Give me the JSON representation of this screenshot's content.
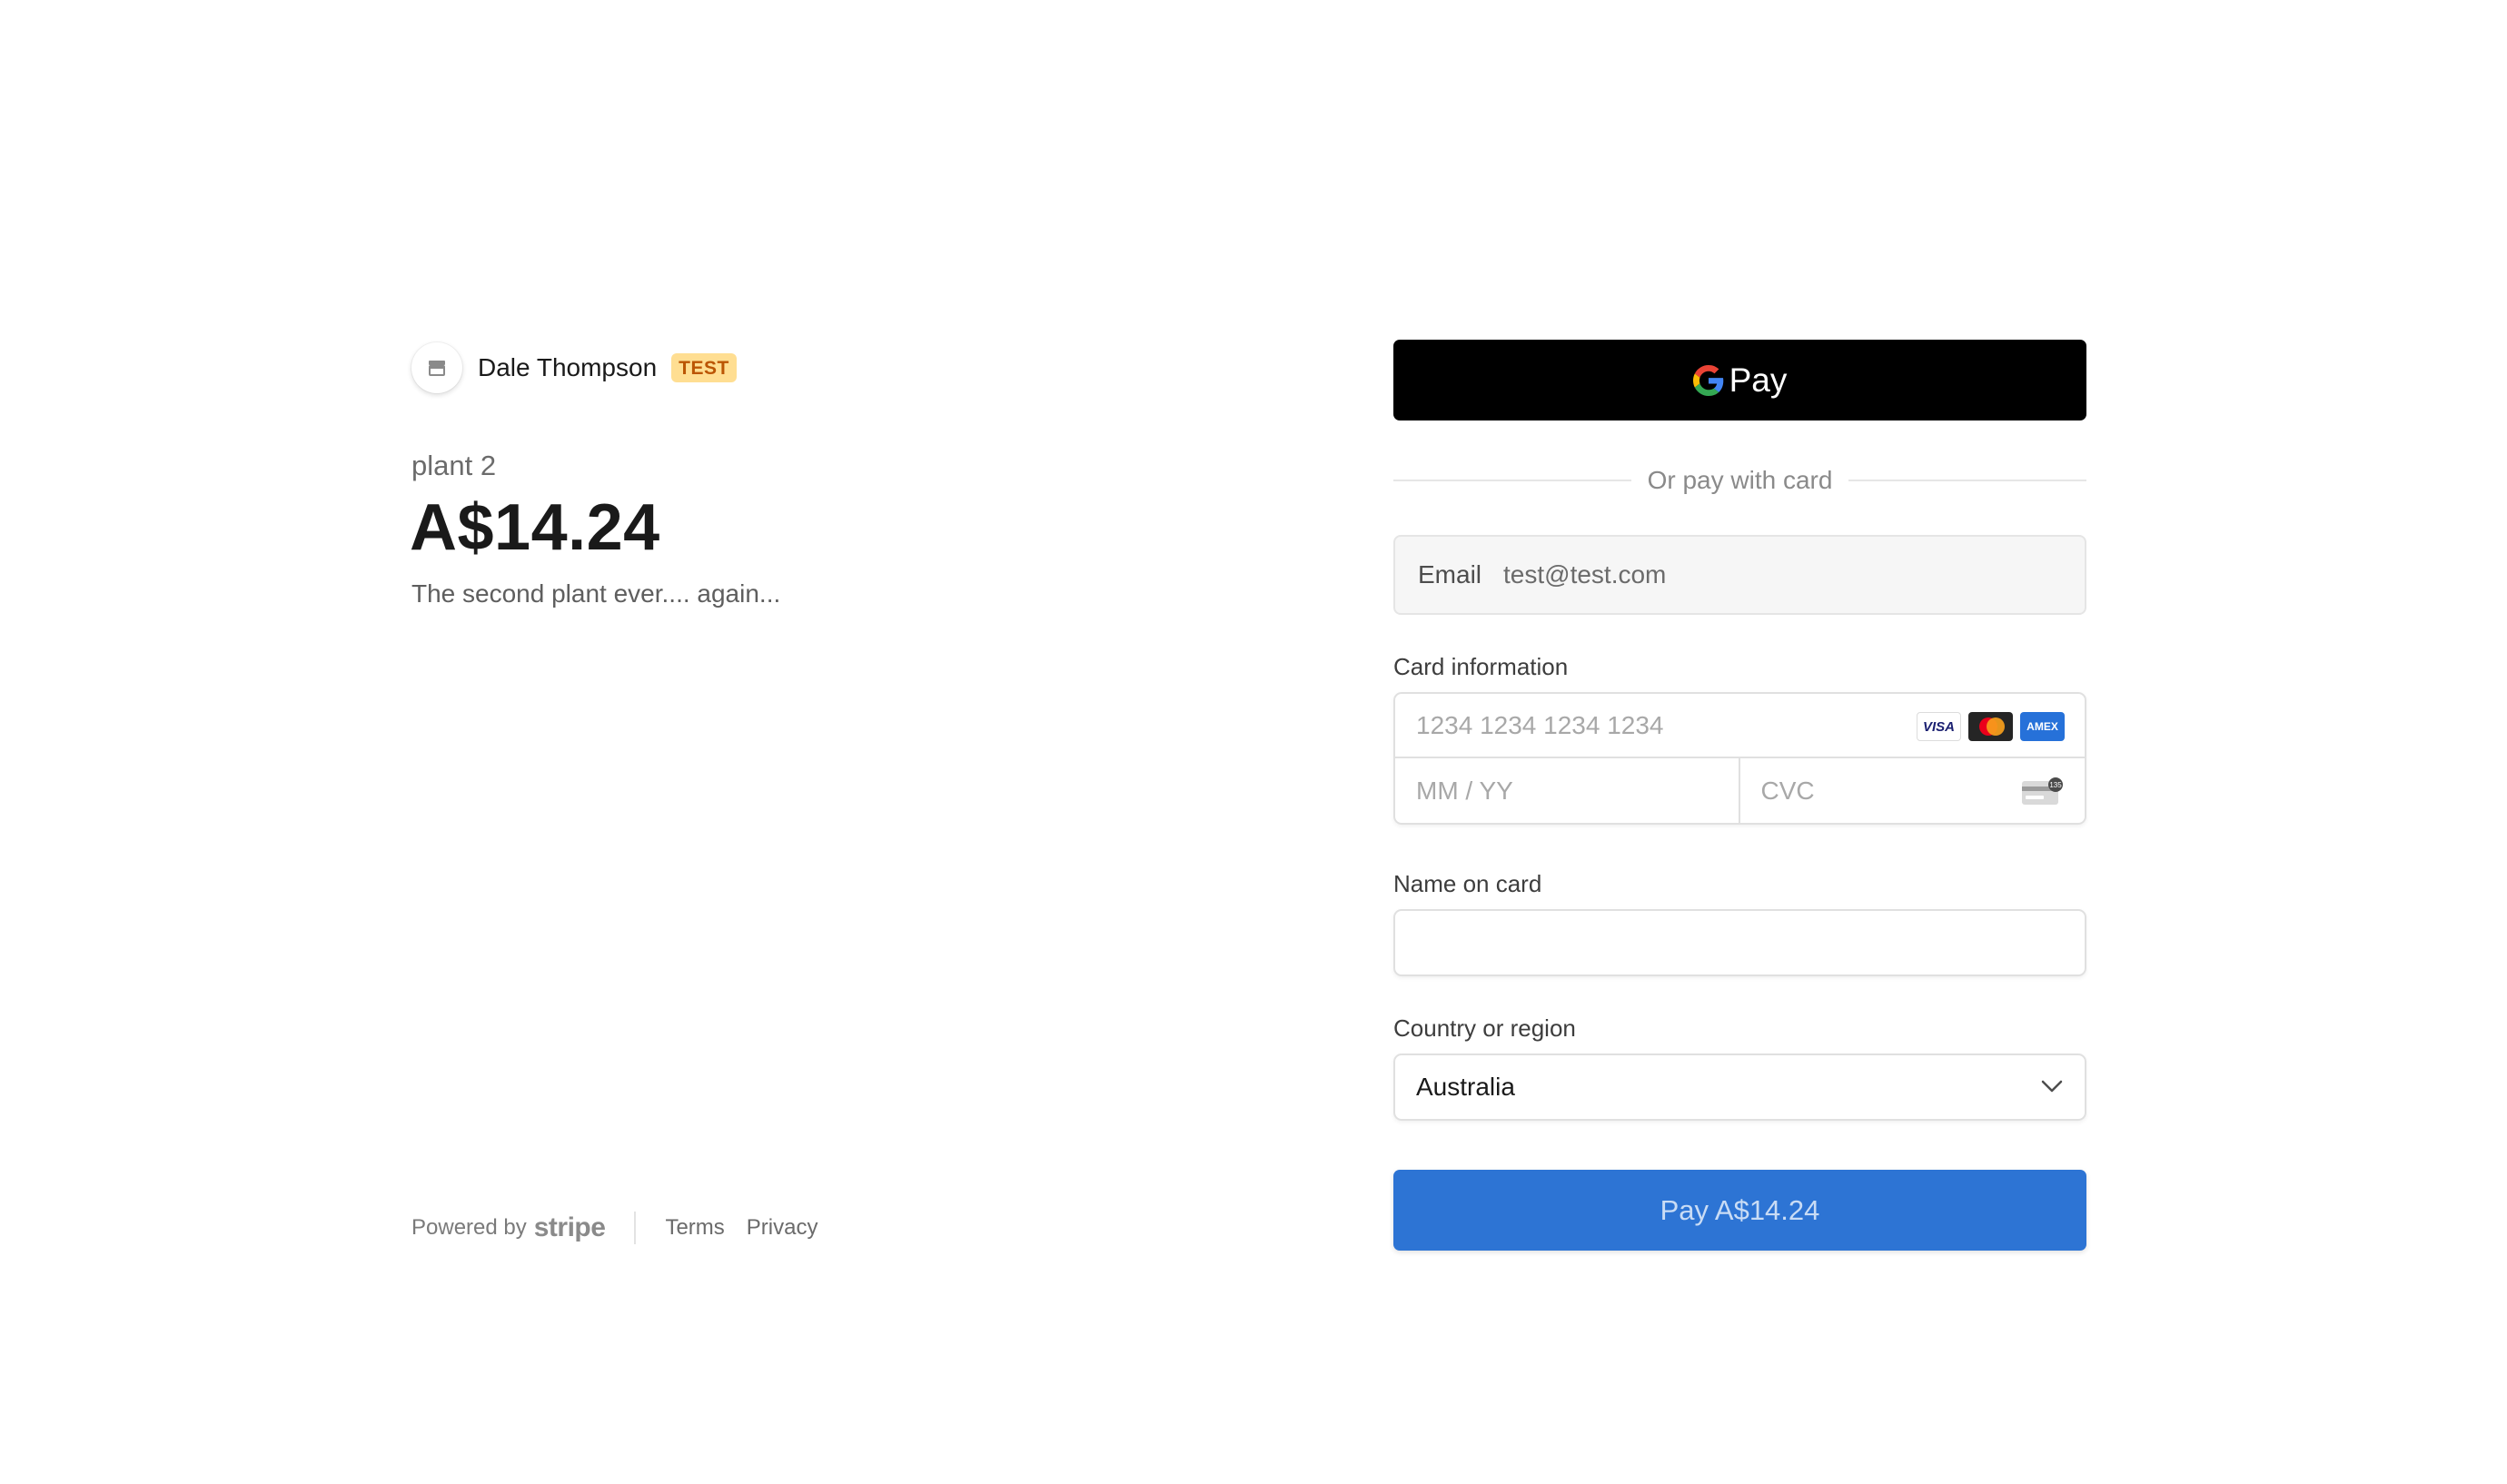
{
  "merchant": {
    "name": "Dale Thompson",
    "badge": "TEST",
    "icon": "store-icon"
  },
  "product": {
    "name": "plant 2",
    "price": "A$14.24",
    "description": "The second plant ever.... again..."
  },
  "footer": {
    "powered_by": "Powered by",
    "brand": "stripe",
    "links": [
      "Terms",
      "Privacy"
    ]
  },
  "gpay": {
    "label": "Pay",
    "icon": "google-g-icon"
  },
  "divider": {
    "text": "Or pay with card"
  },
  "email": {
    "label": "Email",
    "value": "test@test.com"
  },
  "card": {
    "label": "Card information",
    "number_placeholder": "1234 1234 1234 1234",
    "expiry_placeholder": "MM / YY",
    "cvc_placeholder": "CVC",
    "brands": [
      "visa-icon",
      "mastercard-icon",
      "amex-icon"
    ],
    "visa_text": "VISA",
    "amex_text": "AMEX",
    "cvc_icon": "cvc-card-icon"
  },
  "name_on_card": {
    "label": "Name on card",
    "value": ""
  },
  "country": {
    "label": "Country or region",
    "selected": "Australia",
    "icon": "chevron-down-icon"
  },
  "pay_button": {
    "label": "Pay A$14.24"
  },
  "colors": {
    "accent": "#2d74d4",
    "badge_bg": "#ffde92",
    "badge_text": "#bb5504",
    "gpay_bg": "#000000"
  }
}
